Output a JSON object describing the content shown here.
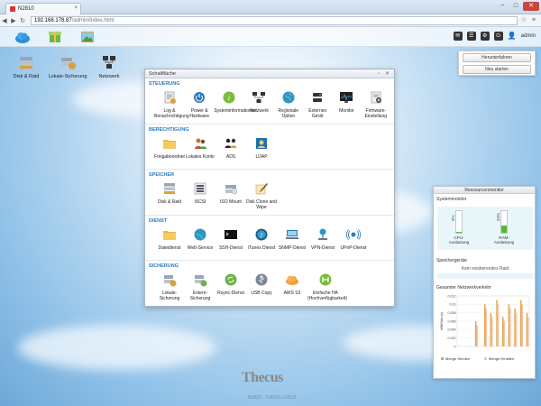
{
  "browser": {
    "tab_title": "N2810",
    "url_host": "192.168.178.87",
    "url_path": "/admin/index.html",
    "win_min": "−",
    "win_max": "□",
    "win_close": "✕",
    "tab_close": "×"
  },
  "topbar": {
    "user": "admin"
  },
  "power_menu": {
    "shutdown": "Herunterfahren",
    "restart": "Neu starten"
  },
  "desktop_shortcuts": [
    {
      "label": "Disk & Raid"
    },
    {
      "label": "Lokale-Sicherung"
    },
    {
      "label": "Netzwerk"
    }
  ],
  "panel": {
    "title": "Schaltfläche",
    "sections": [
      {
        "heading": "STEUERUNG",
        "items": [
          {
            "label": "Log & Benachrichtigung"
          },
          {
            "label": "Power & Hardware"
          },
          {
            "label": "Systeminformationen"
          },
          {
            "label": "Netzwerk"
          },
          {
            "label": "Regionale Option"
          },
          {
            "label": "Externes Gerät"
          },
          {
            "label": "Monitor"
          },
          {
            "label": "Firmware-Einstellung"
          }
        ]
      },
      {
        "heading": "BERECHTIGUNG",
        "items": [
          {
            "label": "Freigabeordner"
          },
          {
            "label": "Lokales Konto"
          },
          {
            "label": "ADS"
          },
          {
            "label": "LDAP"
          }
        ]
      },
      {
        "heading": "SPEICHER",
        "items": [
          {
            "label": "Disk & Raid"
          },
          {
            "label": "iSCSI"
          },
          {
            "label": "ISO Mount"
          },
          {
            "label": "Disk Clone and Wipe"
          }
        ]
      },
      {
        "heading": "DIENST",
        "items": [
          {
            "label": "Dateidienst"
          },
          {
            "label": "Web-Service"
          },
          {
            "label": "SSH-Dienst"
          },
          {
            "label": "iTunes Dienst"
          },
          {
            "label": "SNMP-Dienst"
          },
          {
            "label": "VPN-Dienst"
          },
          {
            "label": "UPnP-Dienst"
          }
        ]
      },
      {
        "heading": "SICHERUNG",
        "items": [
          {
            "label": "Lokale-Sicherung"
          },
          {
            "label": "Extern-Sicherung"
          },
          {
            "label": "Rsync-Dienst"
          },
          {
            "label": "USB Copy"
          },
          {
            "label": "AWS S3"
          },
          {
            "label": "Einfache HA (Hochverfügbarkeit)"
          }
        ]
      }
    ]
  },
  "resource_monitor": {
    "title": "Ressourcenmonitor",
    "system_monitor": "Systemmonitor",
    "cpu_label": "CPU-Auslastung",
    "cpu_pct": "3%",
    "cpu_value": 3,
    "ram_label": "RAM-Auslastung",
    "ram_pct": "34%",
    "ram_value": 34,
    "storage_heading": "Speichergeräte",
    "no_raid": "Kein existierendes Raid",
    "traffic_heading": "Gesamter Netzwerkverkehr",
    "legend_send": "Menge Senden",
    "legend_recv": "Menge Erhalten"
  },
  "footer": {
    "logo": "Thecus",
    "version": "N2810 - 3.00.01.cc2810"
  },
  "chart_data": {
    "type": "bar",
    "ylabel": "MB/Sek (s)",
    "ylim": [
      0,
      0.012
    ],
    "yticks": [
      "0.012",
      "0.01",
      "0.008",
      "0.006",
      "0.004",
      "0.002",
      "0"
    ],
    "series": [
      {
        "name": "Menge Senden",
        "values": [
          0,
          0,
          0,
          0,
          0,
          0,
          0.006,
          0,
          0,
          0.01,
          0,
          0.008,
          0,
          0.011,
          0,
          0.007,
          0,
          0.01,
          0,
          0.009,
          0,
          0.011,
          0,
          0.008
        ]
      },
      {
        "name": "Menge Erhalten",
        "values": [
          0,
          0,
          0,
          0,
          0,
          0,
          0.005,
          0,
          0,
          0.009,
          0,
          0.007,
          0,
          0.01,
          0,
          0.006,
          0,
          0.009,
          0,
          0.008,
          0,
          0.01,
          0,
          0.007
        ]
      }
    ],
    "colors": {
      "send": "#e7a24a",
      "recv": "#f2c9a8"
    }
  }
}
